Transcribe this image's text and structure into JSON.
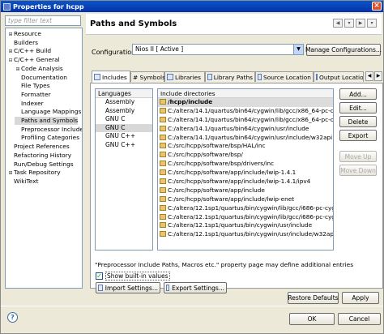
{
  "window": {
    "title": "Properties for hcpp"
  },
  "filter": {
    "placeholder": "type filter text"
  },
  "tree": [
    {
      "label": "Resource",
      "expander": "+",
      "indent": 0
    },
    {
      "label": "Builders",
      "expander": "",
      "indent": 0
    },
    {
      "label": "C/C++ Build",
      "expander": "+",
      "indent": 0
    },
    {
      "label": "C/C++ General",
      "expander": "-",
      "indent": 0
    },
    {
      "label": "Code Analysis",
      "expander": "+",
      "indent": 1
    },
    {
      "label": "Documentation",
      "expander": "",
      "indent": 1
    },
    {
      "label": "File Types",
      "expander": "",
      "indent": 1
    },
    {
      "label": "Formatter",
      "expander": "",
      "indent": 1
    },
    {
      "label": "Indexer",
      "expander": "",
      "indent": 1
    },
    {
      "label": "Language Mappings",
      "expander": "",
      "indent": 1
    },
    {
      "label": "Paths and Symbols",
      "expander": "",
      "indent": 1,
      "selected": true
    },
    {
      "label": "Preprocessor Include",
      "expander": "",
      "indent": 1
    },
    {
      "label": "Profiling Categories",
      "expander": "",
      "indent": 1
    },
    {
      "label": "Project References",
      "expander": "",
      "indent": 0
    },
    {
      "label": "Refactoring History",
      "expander": "",
      "indent": 0
    },
    {
      "label": "Run/Debug Settings",
      "expander": "",
      "indent": 0
    },
    {
      "label": "Task Repository",
      "expander": "+",
      "indent": 0
    },
    {
      "label": "WikiText",
      "expander": "",
      "indent": 0
    }
  ],
  "page": {
    "title": "Paths and Symbols"
  },
  "configuration": {
    "label": "Configuration:",
    "value": "Nios II  [ Active ]",
    "manage_button": "Manage Configurations..."
  },
  "tabs": [
    {
      "label": "Includes",
      "active": true
    },
    {
      "label": "# Symbols"
    },
    {
      "label": "Libraries"
    },
    {
      "label": "Library Paths"
    },
    {
      "label": "Source Location"
    },
    {
      "label": "Output Location"
    }
  ],
  "languages": {
    "header": "Languages",
    "items": [
      "Assembly",
      "Assembly",
      "GNU C",
      "GNU C",
      "GNU C++",
      "GNU C++"
    ],
    "selected_index": 3
  },
  "include_dirs": {
    "header": "Include directories",
    "items": [
      "/hcpp/include",
      "C:/altera/14.1/quartus/bin64/cygwin/lib/gcc/x86_64-pc-cy...",
      "C:/altera/14.1/quartus/bin64/cygwin/lib/gcc/x86_64-pc-cy...",
      "C:/altera/14.1/quartus/bin64/cygwin/usr/include",
      "C:/altera/14.1/quartus/bin64/cygwin/usr/include/w32api",
      "C:/src/hcpp/software/bsp/HAL/inc",
      "C:/src/hcpp/software/bsp/",
      "C:/src/hcpp/software/bsp/drivers/inc",
      "C:/src/hcpp/software/app/include/lwip-1.4.1",
      "C:/src/hcpp/software/app/include/lwip-1.4.1/ipv4",
      "C:/src/hcpp/software/app/include",
      "C:/src/hcpp/software/app/include/lwip-enet",
      "C:/altera/12.1sp1/quartus/bin/cygwin/lib/gcc/i686-pc-cygw...",
      "C:/altera/12.1sp1/quartus/bin/cygwin/lib/gcc/i686-pc-cygw...",
      "C:/altera/12.1sp1/quartus/bin/cygwin/usr/include",
      "C:/altera/12.1sp1/quartus/bin/cygwin/usr/include/w32api"
    ],
    "selected_index": 0
  },
  "side_buttons": {
    "add": "Add...",
    "edit": "Edit...",
    "delete": "Delete",
    "export": "Export",
    "move_up": "Move Up",
    "move_down": "Move Down"
  },
  "note": "\"Preprocessor Include Paths, Macros etc.\" property page may define additional entries",
  "show_builtin": {
    "label": "Show built-in values",
    "checked": true
  },
  "import_button": "Import Settings...",
  "export_button": "Export Settings...",
  "restore_defaults": "Restore Defaults",
  "apply": "Apply",
  "ok": "OK",
  "cancel": "Cancel",
  "colors": {
    "titlebar": "#0a55c8",
    "dialog_bg": "#ece9d8",
    "border": "#7f9db9"
  }
}
